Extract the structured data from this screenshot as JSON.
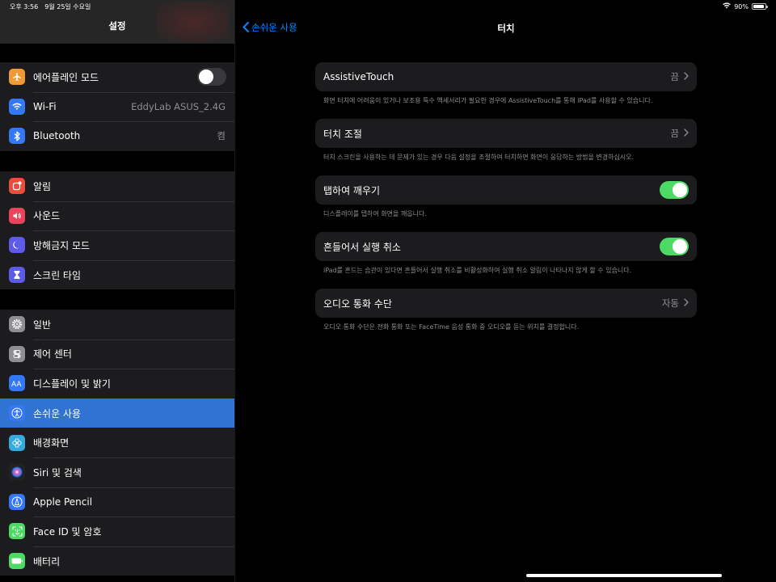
{
  "status": {
    "time": "오후 3:56",
    "date": "9월 25일 수요일",
    "battery": "90%",
    "battery_level": 0.9
  },
  "sidebar": {
    "title": "설정",
    "groups": [
      [
        {
          "label": "에어플레인 모드",
          "icon": "airplane-icon",
          "color": "#f09a37",
          "toggle": "off"
        },
        {
          "label": "Wi-Fi",
          "icon": "wifi-icon",
          "color": "#3478f6",
          "value": "EddyLab ASUS_2.4G"
        },
        {
          "label": "Bluetooth",
          "icon": "bluetooth-icon",
          "color": "#3478f6",
          "value": "켬"
        }
      ],
      [
        {
          "label": "알림",
          "icon": "notifications-icon",
          "color": "#eb4d3d"
        },
        {
          "label": "사운드",
          "icon": "sound-icon",
          "color": "#eb445a"
        },
        {
          "label": "방해금지 모드",
          "icon": "moon-icon",
          "color": "#5e5ce6"
        },
        {
          "label": "스크린 타임",
          "icon": "hourglass-icon",
          "color": "#5e5ce6"
        }
      ],
      [
        {
          "label": "일반",
          "icon": "gear-icon",
          "color": "#8e8e93"
        },
        {
          "label": "제어 센터",
          "icon": "control-center-icon",
          "color": "#8e8e93"
        },
        {
          "label": "디스플레이 및 밝기",
          "icon": "display-icon",
          "color": "#3478f6"
        },
        {
          "label": "손쉬운 사용",
          "icon": "accessibility-icon",
          "color": "#3478f6",
          "active": true
        },
        {
          "label": "배경화면",
          "icon": "wallpaper-icon",
          "color": "#35aadc"
        },
        {
          "label": "Siri 및 검색",
          "icon": "siri-icon",
          "color": "#222"
        },
        {
          "label": "Apple Pencil",
          "icon": "pencil-icon",
          "color": "#3478f6"
        },
        {
          "label": "Face ID 및 암호",
          "icon": "face-id-icon",
          "color": "#4cd964"
        },
        {
          "label": "배터리",
          "icon": "battery-icon",
          "color": "#4cd964"
        }
      ]
    ]
  },
  "main": {
    "back_label": "손쉬운 사용",
    "title": "터치",
    "rows": [
      {
        "label": "AssistiveTouch",
        "value": "끔",
        "desc": "화면 터치에 어려움이 있거나 보조용 특수 액세서리가 필요한 경우에 AssistiveTouch를 통해 iPad를 사용할 수 있습니다."
      },
      {
        "label": "터치 조절",
        "value": "끔",
        "desc": "터치 스크린을 사용하는 데 문제가 있는 경우 다음 설정을 조절하여 터치하면 화면이 응답하는 방법을 변경하십시오."
      },
      {
        "label": "탭하여 깨우기",
        "toggle": "on",
        "desc": "디스플레이를 탭하여 화면을 깨웁니다."
      },
      {
        "label": "흔들어서 실행 취소",
        "toggle": "on",
        "desc": "iPad를 흔드는 습관이 있다면 흔들어서 실행 취소를 비활성화하여 실행 취소 알림이 나타나지 않게 할 수 있습니다."
      },
      {
        "label": "오디오 통화 수단",
        "value": "자동",
        "desc": "오디오 통화 수단은 전화 통화 또는 FaceTime 음성 통화 중 오디오를 듣는 위치를 결정합니다."
      }
    ]
  }
}
